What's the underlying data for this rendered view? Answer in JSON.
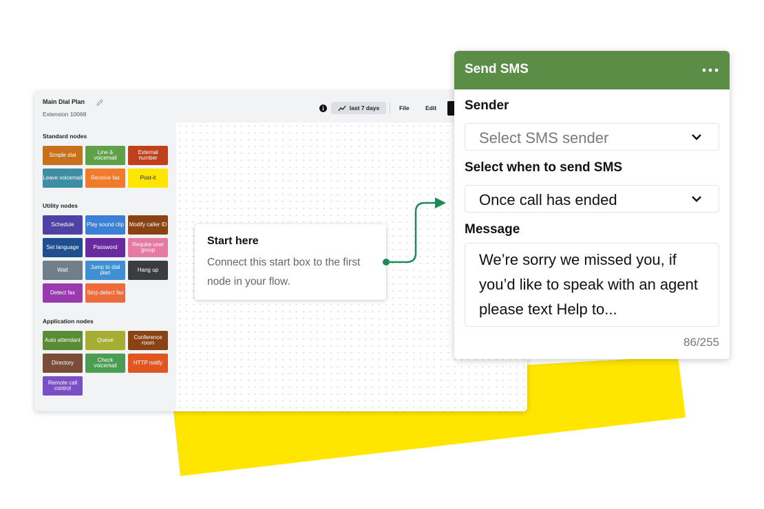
{
  "colors": {
    "yellow": "#ffe600",
    "sms_header": "#5c8d46",
    "connector": "#1f8a55"
  },
  "editor": {
    "title": "Main Dial Plan",
    "subtitle": "Extension 10068",
    "range_label": "last 7 days",
    "menu_file": "File",
    "menu_edit": "Edit",
    "sections": {
      "standard": "Standard nodes",
      "utility": "Utility nodes",
      "application": "Application nodes"
    },
    "standard_nodes": [
      {
        "label": "Simple dial",
        "color": "#c8711d"
      },
      {
        "label": "Line & voicemail",
        "color": "#5ea148"
      },
      {
        "label": "External number",
        "color": "#c1401c"
      },
      {
        "label": "Leave voicemail",
        "color": "#3d8ea3"
      },
      {
        "label": "Receive fax",
        "color": "#ef7b2b"
      },
      {
        "label": "Post-it",
        "color": "#ffe600"
      }
    ],
    "utility_nodes": [
      {
        "label": "Schedule",
        "color": "#4e42a7"
      },
      {
        "label": "Play sound clip",
        "color": "#3b7fd6"
      },
      {
        "label": "Modify caller ID",
        "color": "#8a4212"
      },
      {
        "label": "Set language",
        "color": "#1f4f8f"
      },
      {
        "label": "Password",
        "color": "#6a2aa0"
      },
      {
        "label": "Require user group",
        "color": "#e67aa3"
      },
      {
        "label": "Wait",
        "color": "#6f7e88"
      },
      {
        "label": "Jump to dial plan",
        "color": "#3f8fd4"
      },
      {
        "label": "Hang up",
        "color": "#3a3d40"
      },
      {
        "label": "Detect fax",
        "color": "#9a3aaf"
      },
      {
        "label": "Stop detect fax",
        "color": "#ee6a3a"
      }
    ],
    "application_nodes": [
      {
        "label": "Auto attendant",
        "color": "#5a8c38"
      },
      {
        "label": "Queue",
        "color": "#a5ad33"
      },
      {
        "label": "Conference room",
        "color": "#8a4212"
      },
      {
        "label": "Directory",
        "color": "#7b4c3a"
      },
      {
        "label": "Check voicemail",
        "color": "#4a9d52"
      },
      {
        "label": "HTTP notify",
        "color": "#e0561e"
      },
      {
        "label": "Remote call control",
        "color": "#7a4fc5"
      }
    ]
  },
  "start_box": {
    "title": "Start here",
    "body": "Connect this start box to the first node in your flow."
  },
  "sms_panel": {
    "title": "Send SMS",
    "sender_label": "Sender",
    "sender_placeholder": "Select SMS sender",
    "when_label": "Select when to send SMS",
    "when_value": "Once call has ended",
    "message_label": "Message",
    "message_value": "We’re sorry we missed you, if you’d like to speak with an agent please text Help to...",
    "char_count": "86/255"
  }
}
